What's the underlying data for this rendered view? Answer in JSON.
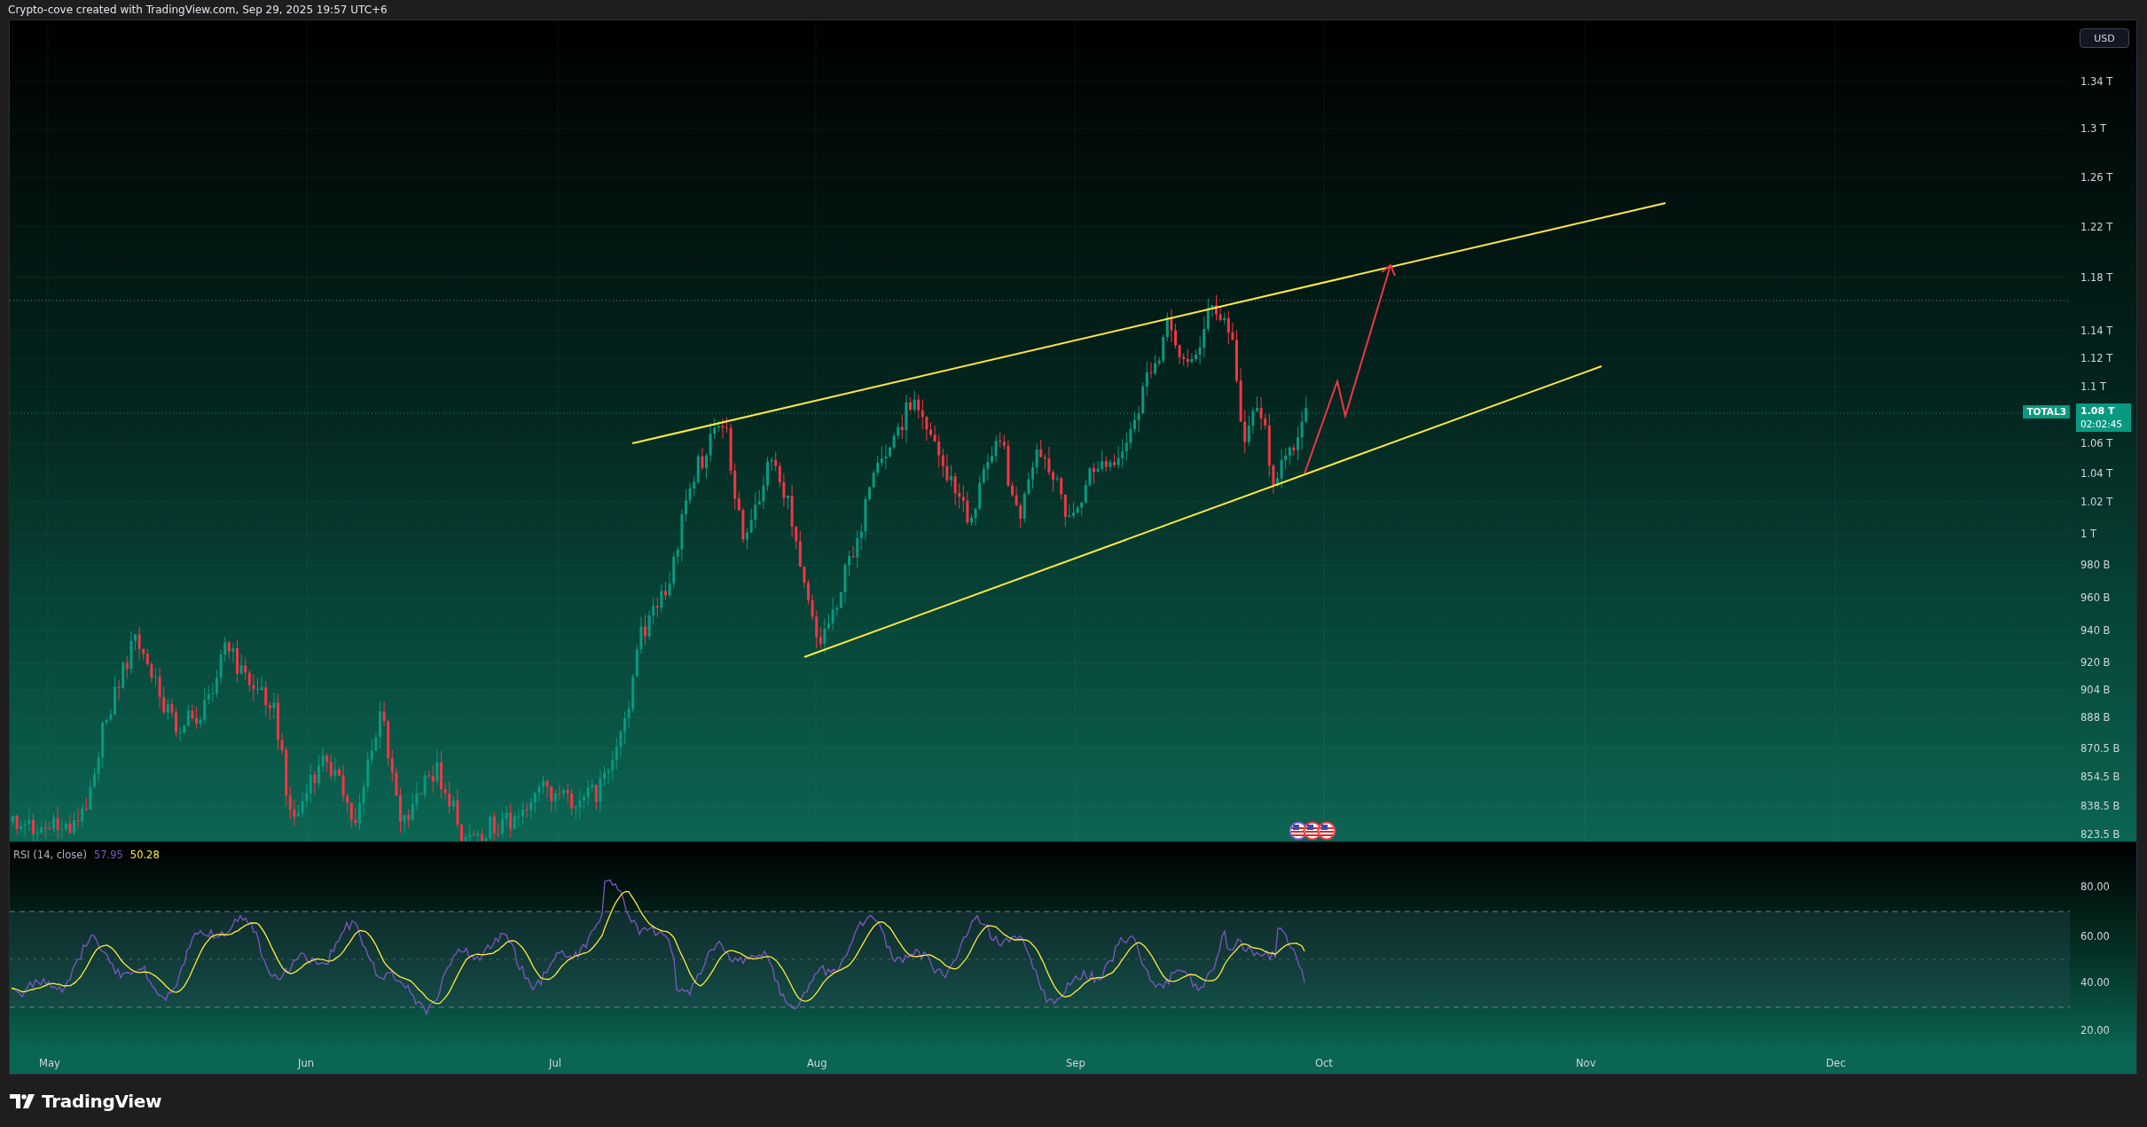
{
  "header": {
    "caption": "Crypto-cove created with TradingView.com, Sep 29, 2025 19:57 UTC+6"
  },
  "price_pane": {
    "currency_button": "USD",
    "symbol_tag": "TOTAL3",
    "last_price": "1.08 T",
    "countdown": "02:02:45",
    "price_labels": [
      "1.34 T",
      "1.3 T",
      "1.26 T",
      "1.22 T",
      "1.18 T",
      "1.14 T",
      "1.12 T",
      "1.1 T",
      "1.06 T",
      "1.04 T",
      "1.02 T",
      "1 T",
      "980 B",
      "960 B",
      "940 B",
      "920 B",
      "904 B",
      "888 B",
      "870.5 B",
      "854.5 B",
      "838.5 B",
      "823.5 B"
    ]
  },
  "rsi_pane": {
    "title": "RSI (14, close)",
    "rsi_value": "57.95",
    "ma_value": "50.28",
    "labels": [
      "80.00",
      "60.00",
      "40.00",
      "20.00"
    ]
  },
  "time_axis": {
    "labels": [
      "May",
      "Jun",
      "Jul",
      "Aug",
      "Sep",
      "Oct",
      "Nov",
      "Dec"
    ]
  },
  "footer": {
    "logo_text": "TradingView"
  }
}
